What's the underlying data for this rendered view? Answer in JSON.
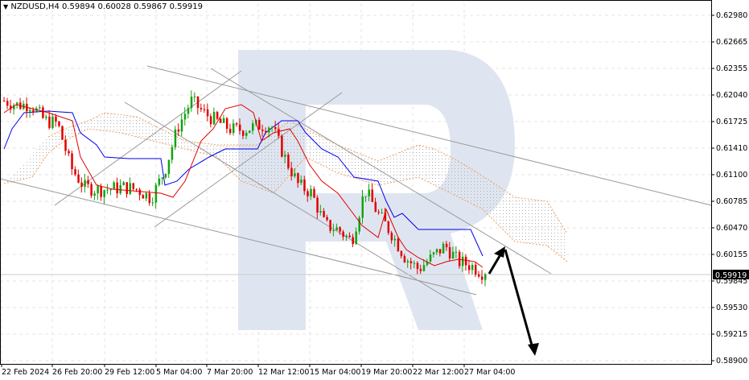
{
  "header": {
    "symbol": "NZDUSD,H4",
    "open": "0.59894",
    "high": "0.60028",
    "low": "0.59867",
    "close": "0.59919",
    "dropdown_icon": "triangle-down-icon"
  },
  "colors": {
    "bull": "#12a312",
    "bear": "#e00000",
    "tenkan": "#e00000",
    "kijun": "#0000ee",
    "cloud": "#f0a060",
    "trend": "#999999",
    "arrow": "#000000",
    "watermark": "#dfe5f0"
  },
  "chart_data": {
    "type": "candlestick",
    "title": "NZDUSD,H4",
    "ylim": [
      0.589,
      0.6298
    ],
    "y_ticks": [
      "0.62980",
      "0.62665",
      "0.62355",
      "0.62040",
      "0.61725",
      "0.61410",
      "0.61100",
      "0.60785",
      "0.60470",
      "0.60155",
      "0.59845",
      "0.59530",
      "0.59215",
      "0.58900"
    ],
    "x_ticks": [
      "22 Feb 2024",
      "26 Feb 20:00",
      "29 Feb 12:00",
      "5 Mar 04:00",
      "7 Mar 20:00",
      "12 Mar 12:00",
      "15 Mar 04:00",
      "19 Mar 20:00",
      "22 Mar 12:00",
      "27 Mar 04:00"
    ],
    "current_price": "0.59919",
    "close_path": [
      0.6197,
      0.6192,
      0.6193,
      0.6174,
      0.617,
      0.6118,
      0.6095,
      0.6092,
      0.6093,
      0.6095,
      0.6092,
      0.6082,
      0.6114,
      0.6166,
      0.6197,
      0.6182,
      0.6172,
      0.6163,
      0.6163,
      0.6168,
      0.6168,
      0.613,
      0.6098,
      0.6088,
      0.605,
      0.6045,
      0.6031,
      0.6092,
      0.6063,
      0.604,
      0.6012,
      0.5998,
      0.6012,
      0.6026,
      0.6007,
      0.6002,
      0.5992
    ]
  }
}
